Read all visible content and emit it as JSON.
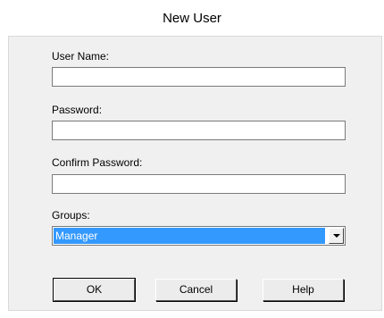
{
  "window": {
    "title": "New User"
  },
  "form": {
    "username": {
      "label": "User Name:",
      "value": ""
    },
    "password": {
      "label": "Password:",
      "value": ""
    },
    "confirm_password": {
      "label": "Confirm Password:",
      "value": ""
    },
    "groups": {
      "label": "Groups:",
      "selected": "Manager"
    }
  },
  "buttons": {
    "ok": "OK",
    "cancel": "Cancel",
    "help": "Help"
  },
  "colors": {
    "selection": "#3399ff",
    "dialog_background": "#f0f0f0"
  },
  "icons": {
    "dropdown": "chevron-down-icon"
  }
}
